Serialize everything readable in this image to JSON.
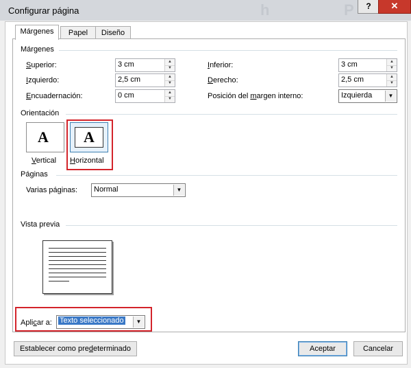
{
  "window": {
    "title": "Configurar página",
    "help_label": "?",
    "close_label": "✕",
    "bg_letter_1": "h",
    "bg_letter_2": "P"
  },
  "tabs": [
    {
      "label": "Márgenes",
      "active": true
    },
    {
      "label": "Papel",
      "active": false
    },
    {
      "label": "Diseño",
      "active": false
    }
  ],
  "margins": {
    "heading": "Márgenes",
    "superior": {
      "label_u": "S",
      "label_rest": "uperior:",
      "value": "3 cm"
    },
    "izquierdo": {
      "label_u": "I",
      "label_rest": "zquierdo:",
      "value": "2,5 cm"
    },
    "encuadernacion": {
      "label_u": "E",
      "label_rest": "ncuadernación:",
      "value": "0 cm"
    },
    "inferior": {
      "label_u": "I",
      "label_rest": "nferior:",
      "value": "3 cm"
    },
    "derecho": {
      "label_u": "D",
      "label_rest": "erecho:",
      "value": "2,5 cm"
    },
    "posicion": {
      "label_pre": "Posición del ",
      "label_u": "m",
      "label_rest": "argen interno:",
      "value": "Izquierda"
    }
  },
  "orientation": {
    "heading": "Orientación",
    "vertical": {
      "label_u": "V",
      "label_rest": "ertical",
      "glyph": "A"
    },
    "horizontal": {
      "label_u": "H",
      "label_rest": "orizontal",
      "glyph": "A",
      "selected": true
    }
  },
  "pages": {
    "heading": "Páginas",
    "multiple": {
      "label_pre": "Varias pá",
      "label_u": "g",
      "label_rest": "inas:",
      "value": "Normal"
    }
  },
  "preview": {
    "heading": "Vista previa"
  },
  "apply": {
    "label_pre": "Apli",
    "label_u": "c",
    "label_rest": "ar a:",
    "value": "Texto seleccionado"
  },
  "buttons": {
    "set_default": {
      "pre": "Establecer como pre",
      "u": "d",
      "rest": "eterminado"
    },
    "accept": "Aceptar",
    "cancel": "Cancelar"
  },
  "icons": {
    "spin_up": "▲",
    "spin_down": "▼",
    "dropdown": "▼"
  },
  "colors": {
    "highlight": "#d3232a",
    "selection": "#3a78c6",
    "titlebar": "#d4d7dc",
    "close": "#c7382b"
  }
}
